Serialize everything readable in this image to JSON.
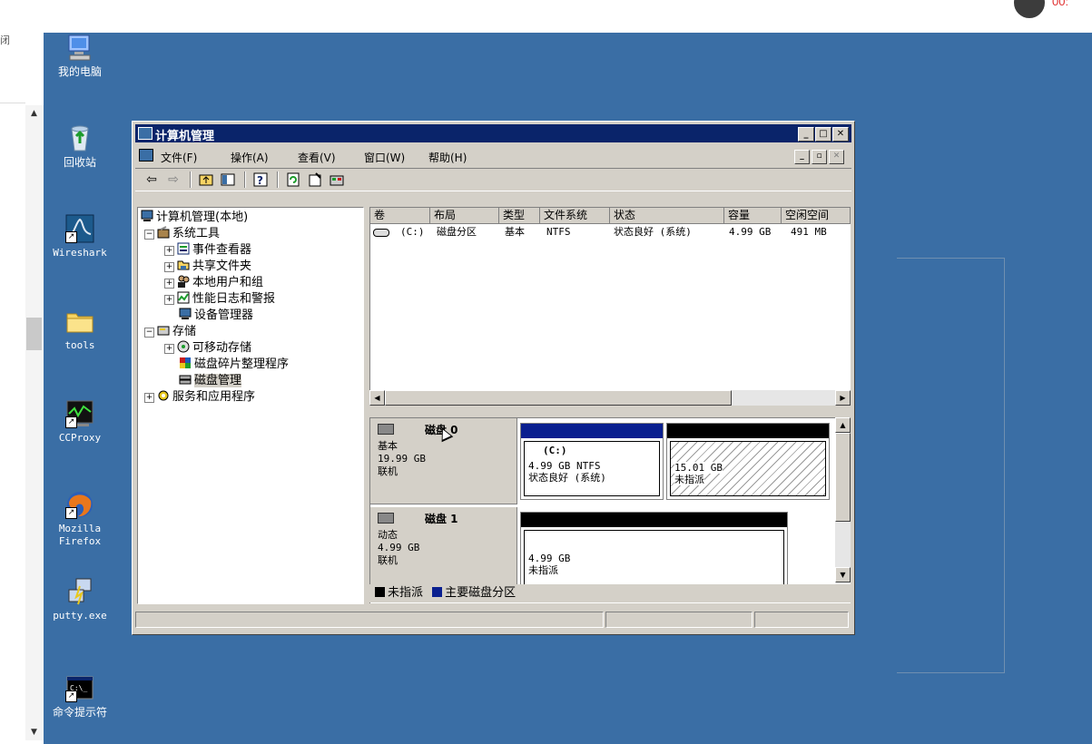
{
  "recorder": {
    "time": "00:"
  },
  "left_panel": {
    "text": "闭"
  },
  "desktop_icons": [
    {
      "label": "我的电脑",
      "icon": "my-computer-icon"
    },
    {
      "label": "回收站",
      "icon": "recycle-bin-icon"
    },
    {
      "label": "Wireshark",
      "icon": "wireshark-icon"
    },
    {
      "label": "tools",
      "icon": "folder-icon"
    },
    {
      "label": "CCProxy",
      "icon": "ccproxy-icon"
    },
    {
      "label": "Mozilla\nFirefox",
      "icon": "firefox-icon"
    },
    {
      "label": "putty.exe",
      "icon": "putty-icon"
    },
    {
      "label": "命令提示符",
      "icon": "cmd-icon"
    }
  ],
  "window": {
    "title": "计算机管理",
    "menu": [
      "文件(F)",
      "操作(A)",
      "查看(V)",
      "窗口(W)",
      "帮助(H)"
    ],
    "toolbar_icons": [
      "back-arrow-icon",
      "forward-arrow-icon",
      "up-folder-icon",
      "show-tree-icon",
      "help-icon",
      "refresh-icon",
      "properties-icon",
      "disk-mgmt-icon"
    ],
    "tree": [
      {
        "label": "计算机管理(本地)",
        "exp": "",
        "icon": "computer-icon"
      },
      {
        "label": "系统工具",
        "exp": "−",
        "icon": "tools-icon"
      },
      {
        "label": "事件查看器",
        "exp": "+",
        "icon": "event-viewer-icon"
      },
      {
        "label": "共享文件夹",
        "exp": "+",
        "icon": "shared-folder-icon"
      },
      {
        "label": "本地用户和组",
        "exp": "+",
        "icon": "users-icon"
      },
      {
        "label": "性能日志和警报",
        "exp": "+",
        "icon": "performance-icon"
      },
      {
        "label": "设备管理器",
        "exp": "",
        "icon": "device-manager-icon"
      },
      {
        "label": "存储",
        "exp": "−",
        "icon": "storage-icon"
      },
      {
        "label": "可移动存储",
        "exp": "+",
        "icon": "removable-storage-icon"
      },
      {
        "label": "磁盘碎片整理程序",
        "exp": "",
        "icon": "defrag-icon"
      },
      {
        "label": "磁盘管理",
        "exp": "",
        "icon": "disk-management-icon"
      },
      {
        "label": "服务和应用程序",
        "exp": "+",
        "icon": "services-icon"
      }
    ],
    "list_headers": [
      "卷",
      "布局",
      "类型",
      "文件系统",
      "状态",
      "容量",
      "空闲空间"
    ],
    "list_rows": [
      {
        "volume": "(C:)",
        "layout": "磁盘分区",
        "type": "基本",
        "fs": "NTFS",
        "status": "状态良好 (系统)",
        "capacity": "4.99 GB",
        "free": "491 MB"
      }
    ],
    "disks": [
      {
        "name": "磁盘 0",
        "kind": "基本",
        "size": "19.99 GB",
        "state": "联机",
        "partitions": [
          {
            "title": "(C:)",
            "line1": "4.99 GB NTFS",
            "line2": "状态良好 (系统)",
            "bar_color": "#0a1f8f"
          },
          {
            "title": "",
            "line1": "15.01 GB",
            "line2": "未指派",
            "bar_color": "#000000"
          }
        ]
      },
      {
        "name": "磁盘 1",
        "kind": "动态",
        "size": "4.99 GB",
        "state": "联机",
        "partitions": [
          {
            "title": "",
            "line1": "4.99 GB",
            "line2": "未指派",
            "bar_color": "#000000"
          }
        ]
      }
    ],
    "legend": [
      {
        "label": "未指派",
        "color": "#000000"
      },
      {
        "label": "主要磁盘分区",
        "color": "#0a1f8f"
      }
    ]
  }
}
